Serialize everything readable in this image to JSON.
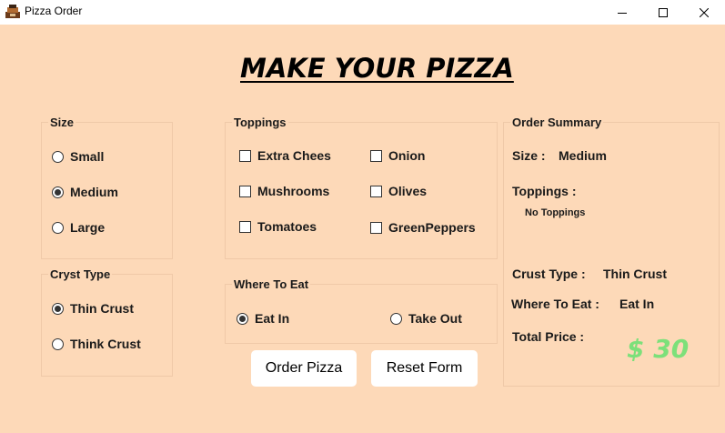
{
  "window": {
    "title": "Pizza Order",
    "icon": "pizza-app-icon",
    "controls": [
      "minimize-icon",
      "maximize-icon",
      "close-icon"
    ]
  },
  "heading": "MAKE YOUR PIZZA",
  "size_group": {
    "label": "Size",
    "options": [
      {
        "label": "Small",
        "checked": false
      },
      {
        "label": "Medium",
        "checked": true
      },
      {
        "label": "Large",
        "checked": false
      }
    ]
  },
  "crust_group": {
    "label": "Cryst Type",
    "options": [
      {
        "label": "Thin Crust",
        "checked": true
      },
      {
        "label": "Think Crust",
        "checked": false
      }
    ]
  },
  "toppings_group": {
    "label": "Toppings",
    "options": [
      {
        "label": "Extra Chees",
        "checked": false
      },
      {
        "label": "Onion",
        "checked": false
      },
      {
        "label": "Mushrooms",
        "checked": false
      },
      {
        "label": "Olives",
        "checked": false
      },
      {
        "label": "Tomatoes",
        "checked": false
      },
      {
        "label": "GreenPeppers",
        "checked": false
      }
    ]
  },
  "where_group": {
    "label": "Where To Eat",
    "options": [
      {
        "label": "Eat In",
        "checked": true
      },
      {
        "label": "Take Out",
        "checked": false
      }
    ]
  },
  "buttons": {
    "order": "Order Pizza",
    "reset": "Reset Form"
  },
  "summary": {
    "label": "Order Summary",
    "size_label": "Size :",
    "size_value": "Medium",
    "toppings_label": "Toppings :",
    "toppings_value": "No Toppings",
    "crust_label": "Crust Type :",
    "crust_value": "Thin Crust",
    "where_label": "Where To Eat :",
    "where_value": "Eat In",
    "total_label": "Total Price :",
    "total_value": "$ 30"
  },
  "colors": {
    "background": "#fdd9b8",
    "price": "#7de07a"
  }
}
